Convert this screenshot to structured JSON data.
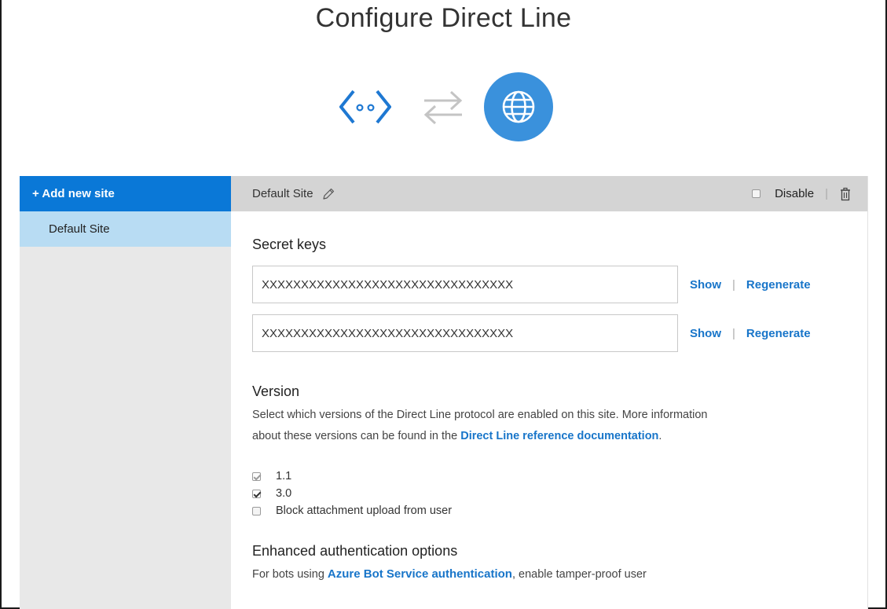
{
  "page_title": "Configure Direct Line",
  "sidebar": {
    "add_site_label": "+ Add new site",
    "items": [
      {
        "label": "Default Site",
        "selected": true
      }
    ]
  },
  "site_header": {
    "name": "Default Site",
    "disable_label": "Disable",
    "disable_checked": false
  },
  "secret_keys": {
    "title": "Secret keys",
    "keys": [
      {
        "value": "XXXXXXXXXXXXXXXXXXXXXXXXXXXXXXXX",
        "show_label": "Show",
        "regenerate_label": "Regenerate"
      },
      {
        "value": "XXXXXXXXXXXXXXXXXXXXXXXXXXXXXXXX",
        "show_label": "Show",
        "regenerate_label": "Regenerate"
      }
    ]
  },
  "version": {
    "title": "Version",
    "desc_part1": "Select which versions of the Direct Line protocol are enabled on this site. More information about these versions can be found in the ",
    "desc_link": "Direct Line reference documentation",
    "desc_part2": ".",
    "options": [
      {
        "label": "1.1",
        "checked": true,
        "disabled": true
      },
      {
        "label": "3.0",
        "checked": true,
        "disabled": false
      },
      {
        "label": "Block attachment upload from user",
        "checked": false,
        "disabled": false
      }
    ]
  },
  "enhanced_auth": {
    "title": "Enhanced authentication options",
    "desc_part1": "For bots using ",
    "desc_link": "Azure Bot Service authentication",
    "desc_part2": ", enable tamper-proof user"
  },
  "colors": {
    "accent": "#0a78d7",
    "globe": "#3a91dc",
    "selected_item": "#b8dcf3",
    "link": "#1875c9"
  },
  "icons": [
    "code-icon",
    "swap-arrows-icon",
    "globe-icon",
    "pencil-icon",
    "trash-icon"
  ]
}
